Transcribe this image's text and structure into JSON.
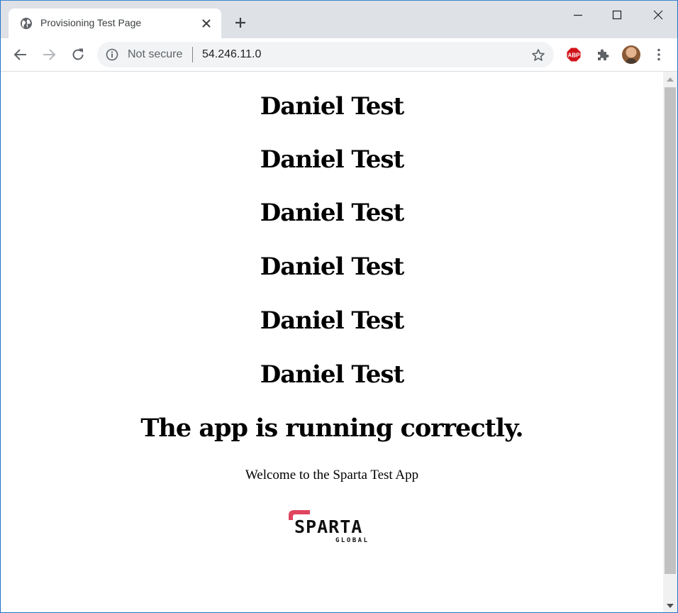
{
  "browser": {
    "tab_title": "Provisioning Test Page",
    "omnibox": {
      "security_label": "Not secure",
      "url": "54.246.11.0"
    },
    "extensions": {
      "adblock_label": "ABP"
    },
    "icons": {
      "favicon": "globe-icon",
      "tab_close": "close-icon",
      "new_tab": "plus-icon",
      "minimize": "minimize-icon",
      "maximize": "maximize-icon",
      "close_window": "close-icon",
      "back": "arrow-left-icon",
      "forward": "arrow-right-icon",
      "reload": "reload-icon",
      "info": "info-icon",
      "bookmark": "star-icon",
      "extensions": "puzzle-icon",
      "menu": "kebab-menu-icon"
    }
  },
  "page": {
    "headings": [
      "Daniel Test",
      "Daniel Test",
      "Daniel Test",
      "Daniel Test",
      "Daniel Test",
      "Daniel Test"
    ],
    "status_heading": "The app is running correctly.",
    "welcome_text": "Welcome to the Sparta Test App",
    "logo": {
      "wordmark": "SPARTA",
      "subtitle": "GLOBAL"
    }
  },
  "colors": {
    "tabstrip_bg": "#dee1e6",
    "omnibox_bg": "#f1f3f4",
    "logo_accent": "#e0445f",
    "adblock_red": "#d1121a"
  }
}
